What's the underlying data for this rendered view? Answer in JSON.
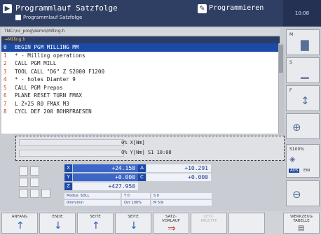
{
  "header": {
    "title": "Programmlauf Satzfolge",
    "subtitle": "Programmlauf Satzfolge",
    "mode": "Programmieren",
    "time": "10:08"
  },
  "path": "TNC:\\nc_prog\\demo\\Milling.h",
  "file": "→Milling.h",
  "program": [
    {
      "num": "0",
      "text": "BEGIN PGM MILLING MM"
    },
    {
      "num": "1",
      "text": "* - Milling operations"
    },
    {
      "num": "2",
      "text": "CALL PGM MILL"
    },
    {
      "num": "3",
      "text": "TOOL CALL \"D6\" Z S2000 F1200"
    },
    {
      "num": "4",
      "text": "* - holes Diamter 9"
    },
    {
      "num": "5",
      "text": "CALL PGM Prepos"
    },
    {
      "num": "6",
      "text": "PLANE RESET TURN FMAX"
    },
    {
      "num": "7",
      "text": "L Z+25 R0 FMAX M3"
    },
    {
      "num": "8",
      "text": "CYCL DEF 200 BOHRFRAESEN"
    }
  ],
  "status": {
    "line1": "0% X[Nm]",
    "line2": "0% Y[Nm] S1   10:08"
  },
  "positions": {
    "x": {
      "axis": "X",
      "value": "+24.150"
    },
    "a": {
      "axis": "A",
      "value": "+10.291"
    },
    "y": {
      "axis": "Y",
      "value": "+0.000"
    },
    "c": {
      "axis": "C",
      "value": "+0.000"
    },
    "z": {
      "axis": "Z",
      "value": "+427.950"
    }
  },
  "info": {
    "mode": "Modus: SOLL",
    "feed": "0mm/min",
    "t": "T 0",
    "s": "S 0",
    "ovr": "Ovr 100%",
    "m": "M 5/9"
  },
  "right_keys": [
    {
      "label": "M",
      "icon": "▇"
    },
    {
      "label": "S",
      "icon": "▁"
    },
    {
      "label": "F",
      "icon": "↕"
    },
    {
      "label": "S100%",
      "icon": "◈"
    },
    {
      "label": "",
      "icon": "⊕"
    }
  ],
  "right_key_extra": {
    "aus": "AUS",
    "ein": "EIN"
  },
  "softkeys": [
    {
      "label": "ANFANG",
      "arrow": "↑",
      "disabled": false
    },
    {
      "label": "ENDE",
      "arrow": "↓",
      "disabled": false
    },
    {
      "label": "SEITE",
      "arrow": "↑",
      "disabled": false
    },
    {
      "label": "SEITE",
      "arrow": "↓",
      "disabled": false
    },
    {
      "label": "SATZ-\nVORLAUF",
      "arrow": "⇒",
      "disabled": false
    },
    {
      "label": "LETZ-\nPALETTE",
      "arrow": "",
      "disabled": true
    },
    {
      "label": "",
      "arrow": "",
      "disabled": true
    },
    {
      "label": "",
      "arrow": "",
      "disabled": true
    },
    {
      "label": "WERKZEUG\nTABELLE",
      "arrow": "▤",
      "disabled": false
    }
  ],
  "colors": {
    "header": "#2f3f63",
    "active_line": "#1d4aa7",
    "line_number": "#c43a2b"
  }
}
